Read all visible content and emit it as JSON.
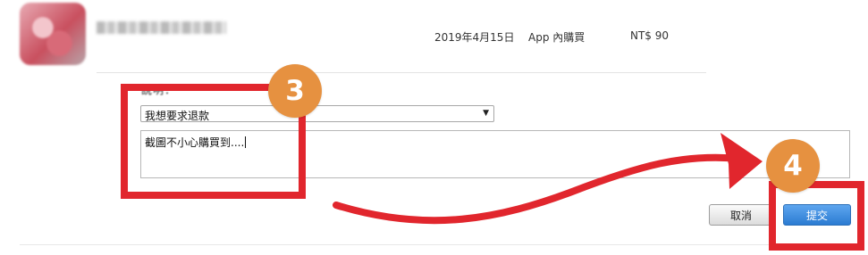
{
  "purchase": {
    "app_name": "",
    "date": "2019年4月15日",
    "type": "App 內購買",
    "price": "NT$ 90"
  },
  "form": {
    "label": "說明：",
    "reason_selected": "我想要求退款",
    "comment_value": "截圖不小心購買到....",
    "cancel_label": "取消",
    "submit_label": "提交"
  },
  "annotations": {
    "step_a": "3",
    "step_b": "4",
    "highlight_color": "#e1262d",
    "badge_color": "#e69140"
  },
  "icons": {
    "dropdown": "chevron-down-icon"
  }
}
